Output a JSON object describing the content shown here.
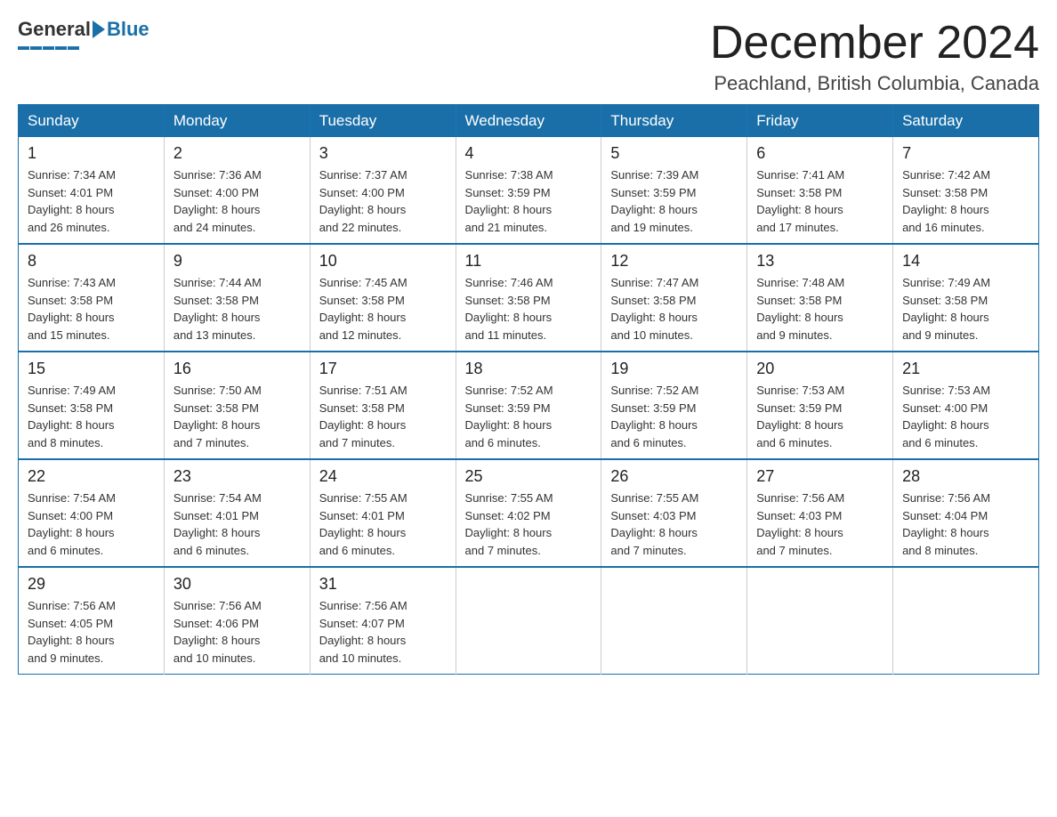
{
  "header": {
    "logo_general": "General",
    "logo_blue": "Blue",
    "month_title": "December 2024",
    "location": "Peachland, British Columbia, Canada"
  },
  "weekdays": [
    "Sunday",
    "Monday",
    "Tuesday",
    "Wednesday",
    "Thursday",
    "Friday",
    "Saturday"
  ],
  "weeks": [
    [
      {
        "day": "1",
        "sunrise": "7:34 AM",
        "sunset": "4:01 PM",
        "daylight": "8 hours and 26 minutes."
      },
      {
        "day": "2",
        "sunrise": "7:36 AM",
        "sunset": "4:00 PM",
        "daylight": "8 hours and 24 minutes."
      },
      {
        "day": "3",
        "sunrise": "7:37 AM",
        "sunset": "4:00 PM",
        "daylight": "8 hours and 22 minutes."
      },
      {
        "day": "4",
        "sunrise": "7:38 AM",
        "sunset": "3:59 PM",
        "daylight": "8 hours and 21 minutes."
      },
      {
        "day": "5",
        "sunrise": "7:39 AM",
        "sunset": "3:59 PM",
        "daylight": "8 hours and 19 minutes."
      },
      {
        "day": "6",
        "sunrise": "7:41 AM",
        "sunset": "3:58 PM",
        "daylight": "8 hours and 17 minutes."
      },
      {
        "day": "7",
        "sunrise": "7:42 AM",
        "sunset": "3:58 PM",
        "daylight": "8 hours and 16 minutes."
      }
    ],
    [
      {
        "day": "8",
        "sunrise": "7:43 AM",
        "sunset": "3:58 PM",
        "daylight": "8 hours and 15 minutes."
      },
      {
        "day": "9",
        "sunrise": "7:44 AM",
        "sunset": "3:58 PM",
        "daylight": "8 hours and 13 minutes."
      },
      {
        "day": "10",
        "sunrise": "7:45 AM",
        "sunset": "3:58 PM",
        "daylight": "8 hours and 12 minutes."
      },
      {
        "day": "11",
        "sunrise": "7:46 AM",
        "sunset": "3:58 PM",
        "daylight": "8 hours and 11 minutes."
      },
      {
        "day": "12",
        "sunrise": "7:47 AM",
        "sunset": "3:58 PM",
        "daylight": "8 hours and 10 minutes."
      },
      {
        "day": "13",
        "sunrise": "7:48 AM",
        "sunset": "3:58 PM",
        "daylight": "8 hours and 9 minutes."
      },
      {
        "day": "14",
        "sunrise": "7:49 AM",
        "sunset": "3:58 PM",
        "daylight": "8 hours and 9 minutes."
      }
    ],
    [
      {
        "day": "15",
        "sunrise": "7:49 AM",
        "sunset": "3:58 PM",
        "daylight": "8 hours and 8 minutes."
      },
      {
        "day": "16",
        "sunrise": "7:50 AM",
        "sunset": "3:58 PM",
        "daylight": "8 hours and 7 minutes."
      },
      {
        "day": "17",
        "sunrise": "7:51 AM",
        "sunset": "3:58 PM",
        "daylight": "8 hours and 7 minutes."
      },
      {
        "day": "18",
        "sunrise": "7:52 AM",
        "sunset": "3:59 PM",
        "daylight": "8 hours and 6 minutes."
      },
      {
        "day": "19",
        "sunrise": "7:52 AM",
        "sunset": "3:59 PM",
        "daylight": "8 hours and 6 minutes."
      },
      {
        "day": "20",
        "sunrise": "7:53 AM",
        "sunset": "3:59 PM",
        "daylight": "8 hours and 6 minutes."
      },
      {
        "day": "21",
        "sunrise": "7:53 AM",
        "sunset": "4:00 PM",
        "daylight": "8 hours and 6 minutes."
      }
    ],
    [
      {
        "day": "22",
        "sunrise": "7:54 AM",
        "sunset": "4:00 PM",
        "daylight": "8 hours and 6 minutes."
      },
      {
        "day": "23",
        "sunrise": "7:54 AM",
        "sunset": "4:01 PM",
        "daylight": "8 hours and 6 minutes."
      },
      {
        "day": "24",
        "sunrise": "7:55 AM",
        "sunset": "4:01 PM",
        "daylight": "8 hours and 6 minutes."
      },
      {
        "day": "25",
        "sunrise": "7:55 AM",
        "sunset": "4:02 PM",
        "daylight": "8 hours and 7 minutes."
      },
      {
        "day": "26",
        "sunrise": "7:55 AM",
        "sunset": "4:03 PM",
        "daylight": "8 hours and 7 minutes."
      },
      {
        "day": "27",
        "sunrise": "7:56 AM",
        "sunset": "4:03 PM",
        "daylight": "8 hours and 7 minutes."
      },
      {
        "day": "28",
        "sunrise": "7:56 AM",
        "sunset": "4:04 PM",
        "daylight": "8 hours and 8 minutes."
      }
    ],
    [
      {
        "day": "29",
        "sunrise": "7:56 AM",
        "sunset": "4:05 PM",
        "daylight": "8 hours and 9 minutes."
      },
      {
        "day": "30",
        "sunrise": "7:56 AM",
        "sunset": "4:06 PM",
        "daylight": "8 hours and 10 minutes."
      },
      {
        "day": "31",
        "sunrise": "7:56 AM",
        "sunset": "4:07 PM",
        "daylight": "8 hours and 10 minutes."
      },
      null,
      null,
      null,
      null
    ]
  ],
  "labels": {
    "sunrise": "Sunrise:",
    "sunset": "Sunset:",
    "daylight": "Daylight:"
  }
}
